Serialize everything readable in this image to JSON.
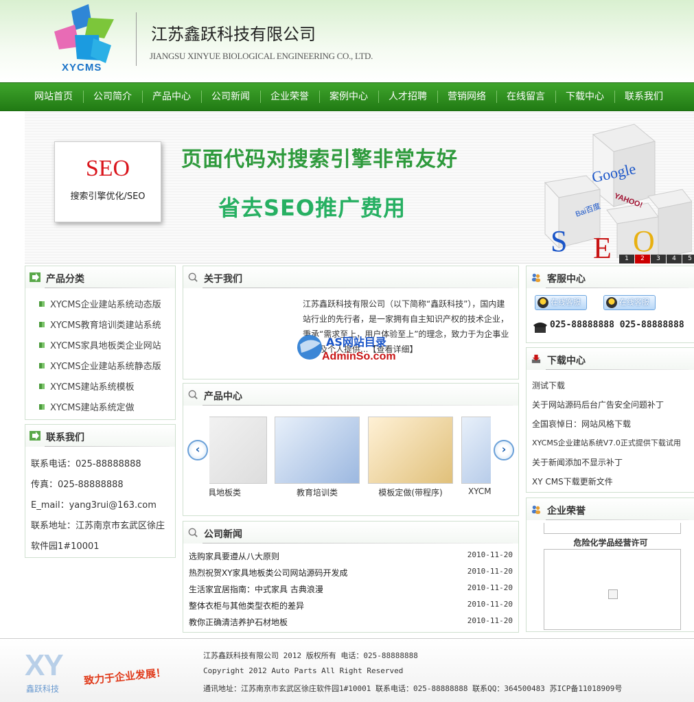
{
  "header": {
    "logo_text": "XYCMS",
    "company_name": "江苏鑫跃科技有限公司",
    "company_en": "JIANGSU XINYUE BIOLOGICAL ENGINEERING CO., LTD."
  },
  "nav": [
    "网站首页",
    "公司简介",
    "产品中心",
    "公司新闻",
    "企业荣誉",
    "案例中心",
    "人才招聘",
    "营销网络",
    "在线留言",
    "下载中心",
    "联系我们"
  ],
  "banner": {
    "card_big": "SEO",
    "card_small": "搜索引擎优化/SEO",
    "line1": "页面代码对搜索引擎非常友好",
    "line2": "省去SEO推广费用",
    "cube_google": "Google",
    "cube_baidu": "Bai百度",
    "cube_yahoo": "YAHOO!",
    "slides": [
      "1",
      "2",
      "3",
      "4",
      "5"
    ],
    "active_slide": 2
  },
  "categories": {
    "title": "产品分类",
    "items": [
      "XYCMS企业建站系统动态版",
      "XYCMS教育培训类建站系统",
      "XYCMS家具地板类企业网站",
      "XYCMS企业建站系统静态版",
      "XYCMS建站系统模板",
      "XYCMS建站系统定做"
    ]
  },
  "contact": {
    "title": "联系我们",
    "lines": [
      "联系电话：025-88888888",
      "传真：025-88888888",
      "E_mail：yang3rui@163.com",
      "联系地址：江苏南京市玄武区徐庄",
      "软件园1#10001"
    ]
  },
  "about": {
    "title": "关于我们",
    "text": "江苏鑫跃科技有限公司（以下简称“鑫跃科技”），国内建站行业的先行者，是一家拥有自主知识产权的技术企业，秉承“需求至上，用户体验至上”的理念，致力于为企事业单位及个人提供...【查看详细】",
    "watermark_cn": "AS网站目录",
    "watermark_en": "AdminSo.com"
  },
  "products": {
    "title": "产品中心",
    "items": [
      "具地板类",
      "教育培训类",
      "模板定做(带程序)",
      "XYCMS"
    ]
  },
  "news": {
    "title": "公司新闻",
    "items": [
      {
        "title": "选购家具要遵从八大原则",
        "date": "2010-11-20"
      },
      {
        "title": "热烈祝贺XY家具地板类公司网站源码开发成",
        "date": "2010-11-20"
      },
      {
        "title": "生活家宜居指南：中式家具 古典浪漫",
        "date": "2010-11-20"
      },
      {
        "title": "整体衣柜与其他类型衣柜的差异",
        "date": "2010-11-20"
      },
      {
        "title": "教你正确清洁养护石材地板",
        "date": "2010-11-20"
      }
    ]
  },
  "service": {
    "title": "客服中心",
    "qq_label": "在线客服",
    "phone": "025-88888888 025-88888888"
  },
  "downloads": {
    "title": "下载中心",
    "items": [
      "测试下载",
      "关于网站源码后台广告安全问题补丁",
      "全国哀悼日：网站风格下载",
      "XYCMS企业建站系统V7.0正式提供下载试用",
      "关于新闻添加不显示补丁",
      "XY CMS下载更新文件"
    ]
  },
  "honors": {
    "title": "企业荣誉",
    "caption": "危险化学品经营许可"
  },
  "footer": {
    "logo": "XY",
    "logo_sub": "鑫跃科技",
    "slogan": "致力于企业发展！",
    "line1": "江苏鑫跃科技有限公司 2012 版权所有 电话：025-88888888",
    "line2": "Copyright 2012 Auto Parts All Right Reserved",
    "line3": "通讯地址：江苏南京市玄武区徐庄软件园1#10001 联系电话：025-88888888 联系QQ：364500483    苏ICP备11018909号"
  },
  "colors": {
    "nav_green": "#2e8f1e",
    "accent_red": "#d9141b",
    "text": "#333333"
  }
}
